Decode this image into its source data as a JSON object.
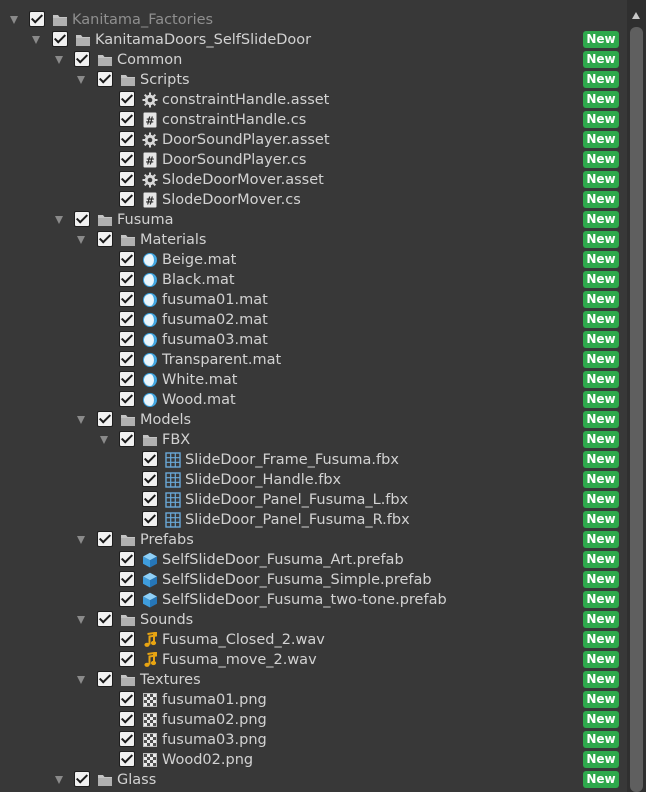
{
  "tree": [
    {
      "label": "Kanitama_Factories",
      "depth": 0,
      "icon": "folder-icon",
      "expanded": true,
      "dim": true,
      "badge": ""
    },
    {
      "label": "KanitamaDoors_SelfSlideDoor",
      "depth": 1,
      "icon": "folder-icon",
      "expanded": true,
      "badge": "New"
    },
    {
      "label": "Common",
      "depth": 2,
      "icon": "folder-icon",
      "expanded": true,
      "badge": "New"
    },
    {
      "label": "Scripts",
      "depth": 3,
      "icon": "folder-icon",
      "expanded": true,
      "badge": "New"
    },
    {
      "label": "constraintHandle.asset",
      "depth": 4,
      "icon": "gear-icon",
      "badge": "New"
    },
    {
      "label": "constraintHandle.cs",
      "depth": 4,
      "icon": "csharp-script-icon",
      "badge": "New"
    },
    {
      "label": "DoorSoundPlayer.asset",
      "depth": 4,
      "icon": "gear-icon",
      "badge": "New"
    },
    {
      "label": "DoorSoundPlayer.cs",
      "depth": 4,
      "icon": "csharp-script-icon",
      "badge": "New"
    },
    {
      "label": "SlodeDoorMover.asset",
      "depth": 4,
      "icon": "gear-icon",
      "badge": "New"
    },
    {
      "label": "SlodeDoorMover.cs",
      "depth": 4,
      "icon": "csharp-script-icon",
      "badge": "New"
    },
    {
      "label": "Fusuma",
      "depth": 2,
      "icon": "folder-icon",
      "expanded": true,
      "badge": "New"
    },
    {
      "label": "Materials",
      "depth": 3,
      "icon": "folder-icon",
      "expanded": true,
      "badge": "New"
    },
    {
      "label": "Beige.mat",
      "depth": 4,
      "icon": "material-icon",
      "badge": "New"
    },
    {
      "label": "Black.mat",
      "depth": 4,
      "icon": "material-icon",
      "badge": "New"
    },
    {
      "label": "fusuma01.mat",
      "depth": 4,
      "icon": "material-icon",
      "badge": "New"
    },
    {
      "label": "fusuma02.mat",
      "depth": 4,
      "icon": "material-icon",
      "badge": "New"
    },
    {
      "label": "fusuma03.mat",
      "depth": 4,
      "icon": "material-icon",
      "badge": "New"
    },
    {
      "label": "Transparent.mat",
      "depth": 4,
      "icon": "material-icon",
      "badge": "New"
    },
    {
      "label": "White.mat",
      "depth": 4,
      "icon": "material-icon",
      "badge": "New"
    },
    {
      "label": "Wood.mat",
      "depth": 4,
      "icon": "material-icon",
      "badge": "New"
    },
    {
      "label": "Models",
      "depth": 3,
      "icon": "folder-icon",
      "expanded": true,
      "badge": "New"
    },
    {
      "label": "FBX",
      "depth": 4,
      "icon": "folder-icon",
      "expanded": true,
      "badge": "New"
    },
    {
      "label": "SlideDoor_Frame_Fusuma.fbx",
      "depth": 5,
      "icon": "mesh-icon",
      "badge": "New"
    },
    {
      "label": "SlideDoor_Handle.fbx",
      "depth": 5,
      "icon": "mesh-icon",
      "badge": "New"
    },
    {
      "label": "SlideDoor_Panel_Fusuma_L.fbx",
      "depth": 5,
      "icon": "mesh-icon",
      "badge": "New"
    },
    {
      "label": "SlideDoor_Panel_Fusuma_R.fbx",
      "depth": 5,
      "icon": "mesh-icon",
      "badge": "New"
    },
    {
      "label": "Prefabs",
      "depth": 3,
      "icon": "folder-icon",
      "expanded": true,
      "badge": "New"
    },
    {
      "label": "SelfSlideDoor_Fusuma_Art.prefab",
      "depth": 4,
      "icon": "prefab-icon",
      "badge": "New"
    },
    {
      "label": "SelfSlideDoor_Fusuma_Simple.prefab",
      "depth": 4,
      "icon": "prefab-icon",
      "badge": "New"
    },
    {
      "label": "SelfSlideDoor_Fusuma_two-tone.prefab",
      "depth": 4,
      "icon": "prefab-icon",
      "badge": "New"
    },
    {
      "label": "Sounds",
      "depth": 3,
      "icon": "folder-icon",
      "expanded": true,
      "badge": "New"
    },
    {
      "label": "Fusuma_Closed_2.wav",
      "depth": 4,
      "icon": "audio-icon",
      "badge": "New"
    },
    {
      "label": "Fusuma_move_2.wav",
      "depth": 4,
      "icon": "audio-icon",
      "badge": "New"
    },
    {
      "label": "Textures",
      "depth": 3,
      "icon": "folder-icon",
      "expanded": true,
      "badge": "New"
    },
    {
      "label": "fusuma01.png",
      "depth": 4,
      "icon": "texture-icon",
      "badge": "New"
    },
    {
      "label": "fusuma02.png",
      "depth": 4,
      "icon": "texture-icon",
      "badge": "New"
    },
    {
      "label": "fusuma03.png",
      "depth": 4,
      "icon": "texture-icon",
      "badge": "New"
    },
    {
      "label": "Wood02.png",
      "depth": 4,
      "icon": "texture-icon",
      "badge": "New"
    },
    {
      "label": "Glass",
      "depth": 2,
      "icon": "folder-icon",
      "expanded": true,
      "badge": "New"
    }
  ],
  "colors": {
    "background": "#383838",
    "badge": "#2ea84c",
    "folder": "#c4c4c4",
    "material": "#3aa3e0",
    "prefab": "#4aa8e6",
    "audio": "#e8a412",
    "mesh": "#6aa9d8"
  }
}
